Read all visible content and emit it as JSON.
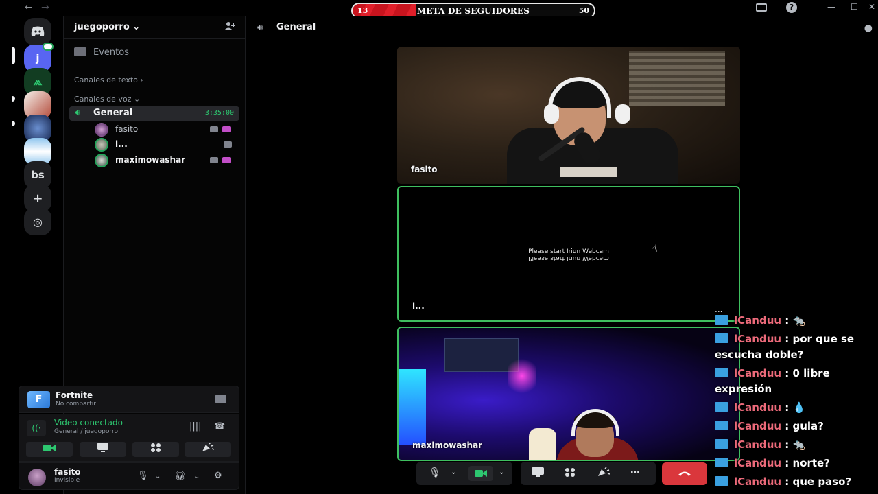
{
  "titlebar": {
    "back": "←",
    "forward": "→",
    "inbox_icon": "inbox-icon",
    "help_icon": "help-icon",
    "minimize": "—",
    "maximize": "☐",
    "close": "✕"
  },
  "goal": {
    "title": "META DE SEGUIDORES",
    "current": "13",
    "target": "50",
    "progress": 0.26,
    "fill_color": "#d81e28"
  },
  "rail": {
    "servers": [
      {
        "name": "discord-home",
        "label": ""
      },
      {
        "name": "juegoporro",
        "label": "j"
      },
      {
        "name": "server-green",
        "label": ""
      },
      {
        "name": "server-drawing",
        "label": ""
      },
      {
        "name": "server-blue",
        "label": ""
      },
      {
        "name": "server-flag",
        "label": ""
      },
      {
        "name": "server-bs",
        "label": "bs"
      },
      {
        "name": "add-server",
        "label": "+"
      },
      {
        "name": "discover",
        "label": "◎"
      }
    ]
  },
  "sidebar": {
    "guild_name": "juegoporro",
    "guild_chevron": "⌄",
    "events_label": "Eventos",
    "text_category": "Canales de texto",
    "voice_category": "Canales de voz",
    "voice_channel": {
      "name": "General",
      "timer": "3:35:00"
    },
    "members": [
      {
        "name": "fasito",
        "camera": true,
        "live": true
      },
      {
        "name": "l...",
        "camera": true,
        "live": false
      },
      {
        "name": "maximowashar",
        "camera": true,
        "live": true
      }
    ]
  },
  "activity": {
    "game": "Fortnite",
    "game_icon": "F",
    "status": "No compartir"
  },
  "voice_panel": {
    "title": "Video conectado",
    "subtitle": "General / juegoporro",
    "buttons": [
      "camera",
      "screen-share",
      "activities",
      "soundboard"
    ]
  },
  "user_panel": {
    "name": "fasito",
    "status": "Invisible"
  },
  "main": {
    "channel_name": "General",
    "tiles": [
      {
        "label": "fasito"
      },
      {
        "label": "l...",
        "message": "Please start Iriun Webcam"
      },
      {
        "label": "maximowashar"
      }
    ],
    "more_label": "..."
  },
  "chat": [
    {
      "user": "lCanduu",
      "text": ": 🐀"
    },
    {
      "user": "lCanduu",
      "text": ": por que se escucha doble?"
    },
    {
      "user": "lCanduu",
      "text": ": 0 libre expresión"
    },
    {
      "user": "lCanduu",
      "text": ": 💧"
    },
    {
      "user": "lCanduu",
      "text": ": gula?"
    },
    {
      "user": "lCanduu",
      "text": ": 🐀"
    },
    {
      "user": "lCanduu",
      "text": ": norte?"
    },
    {
      "user": "lCanduu",
      "text": ": que paso?"
    }
  ],
  "colors": {
    "accent_green": "#2dc770",
    "hangup_red": "#da373c",
    "chat_name": "#ec6a7a",
    "speaking_border": "#3fbf5f"
  }
}
